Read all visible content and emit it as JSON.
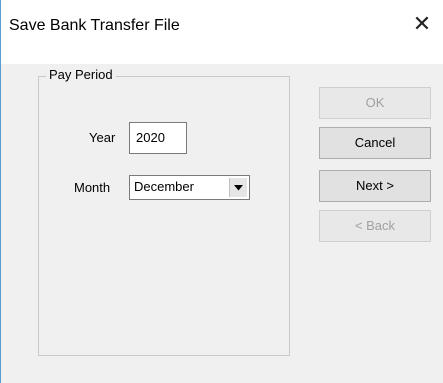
{
  "window": {
    "title": "Save Bank Transfer File",
    "close_symbol": "✕"
  },
  "pay_period": {
    "group_label": "Pay Period",
    "year_label": "Year",
    "year_value": "2020",
    "month_label": "Month",
    "month_value": "December"
  },
  "buttons": {
    "ok": "OK",
    "cancel": "Cancel",
    "next": "Next >",
    "back": "< Back"
  },
  "icons": {
    "close": "close-icon",
    "dropdown": "chevron-down-icon"
  },
  "colors": {
    "window_border": "#5b9bd5",
    "disabled_text": "#a0a0a0"
  }
}
